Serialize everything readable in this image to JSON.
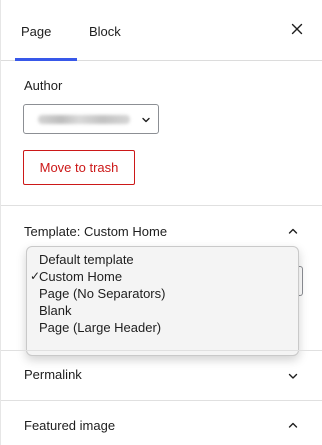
{
  "tabs": [
    {
      "label": "Page",
      "active": true
    },
    {
      "label": "Block",
      "active": false
    }
  ],
  "close_icon": "close-icon",
  "accent_color": "#3858e9",
  "author": {
    "label": "Author",
    "selected_value_blurred": true
  },
  "trash": {
    "label": "Move to trash",
    "color": "#cc1818"
  },
  "template": {
    "title": "Template: Custom Home",
    "expanded": true,
    "options": [
      {
        "label": "Default template",
        "selected": false
      },
      {
        "label": "Custom Home",
        "selected": true
      },
      {
        "label": "Page (No Separators)",
        "selected": false
      },
      {
        "label": "Blank",
        "selected": false
      },
      {
        "label": "Page (Large Header)",
        "selected": false
      }
    ],
    "check_mark": "✓"
  },
  "permalink": {
    "title": "Permalink",
    "expanded": false
  },
  "featured_image": {
    "title": "Featured image",
    "expanded": true
  }
}
